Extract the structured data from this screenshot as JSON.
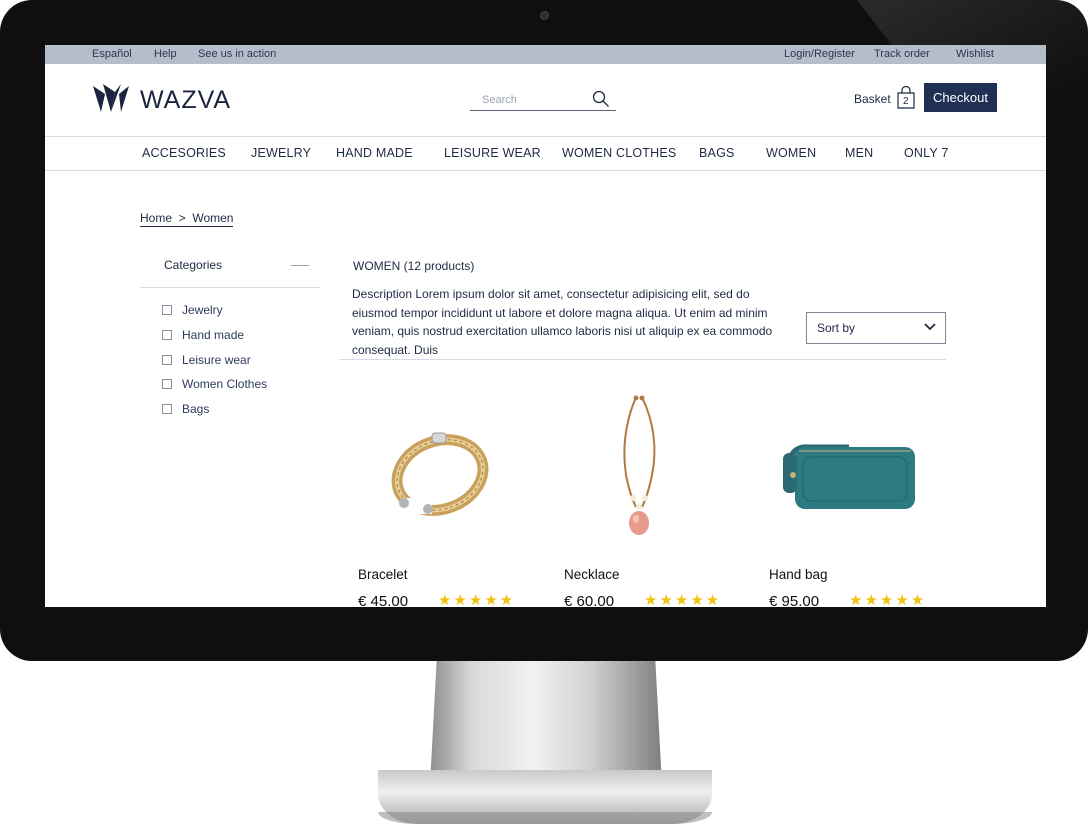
{
  "topbar": {
    "language": "Español",
    "help": "Help",
    "see_us": "See us in action",
    "login": "Login/Register",
    "track": "Track order",
    "wishlist": "Wishlist"
  },
  "header": {
    "logo": "WAZVA",
    "search_placeholder": "Search",
    "basket_label": "Basket",
    "basket_count": "2",
    "checkout": "Checkout"
  },
  "nav": [
    "ACCESORIES",
    "JEWELRY",
    "HAND MADE",
    "LEISURE WEAR",
    "WOMEN CLOTHES",
    "BAGS",
    "WOMEN",
    "MEN",
    "ONLY 7"
  ],
  "breadcrumb": "Home  >  Women",
  "sidebar": {
    "title": "Categories",
    "items": [
      "Jewelry",
      "Hand made",
      "Leisure wear",
      "Women Clothes",
      "Bags"
    ]
  },
  "main": {
    "title": "WOMEN (12 products)",
    "description": "Description Lorem ipsum dolor sit amet, consectetur adipisicing elit, sed do eiusmod tempor incididunt ut labore et dolore magna aliqua. Ut enim ad minim veniam, quis nostrud exercitation ullamco laboris nisi ut aliquip ex ea commodo consequat. Duis",
    "sort_label": "Sort by"
  },
  "products": [
    {
      "name": "Bracelet",
      "price": "€ 45.00",
      "rating": 5,
      "stars": "★★★★★"
    },
    {
      "name": "Necklace",
      "price": "€ 60.00",
      "rating": 5,
      "stars": "★★★★★"
    },
    {
      "name": "Hand bag",
      "price": "€ 95.00",
      "rating": 5,
      "stars": "★★★★★"
    }
  ],
  "colors": {
    "brand_navy": "#1f3054",
    "topbar_bg": "#b4becb",
    "star": "#f4c20d",
    "monitor_bezel": "#0f0f0f"
  }
}
